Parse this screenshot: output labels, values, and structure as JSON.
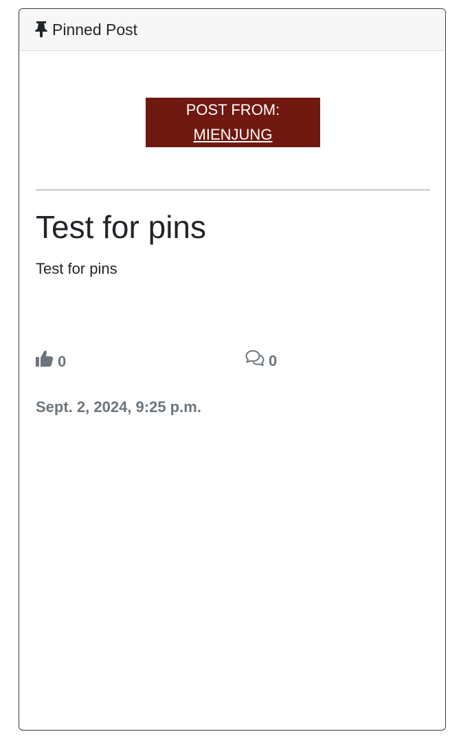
{
  "card": {
    "header_label": "Pinned Post",
    "header_icon": "thumbtack-icon"
  },
  "post": {
    "author_prefix": "POST FROM:",
    "author_name": "MIENJUNG",
    "title": "Test for pins",
    "content": "Test for pins",
    "likes_count": "0",
    "comments_count": "0",
    "created_at": "Sept. 2, 2024, 9:25 p.m."
  },
  "colors": {
    "author_box_bg": "#701911",
    "muted_text": "#6c757d",
    "header_bg": "#f7f7f7"
  },
  "icons": {
    "likes": "thumbs-up-icon",
    "comments": "comments-icon"
  }
}
